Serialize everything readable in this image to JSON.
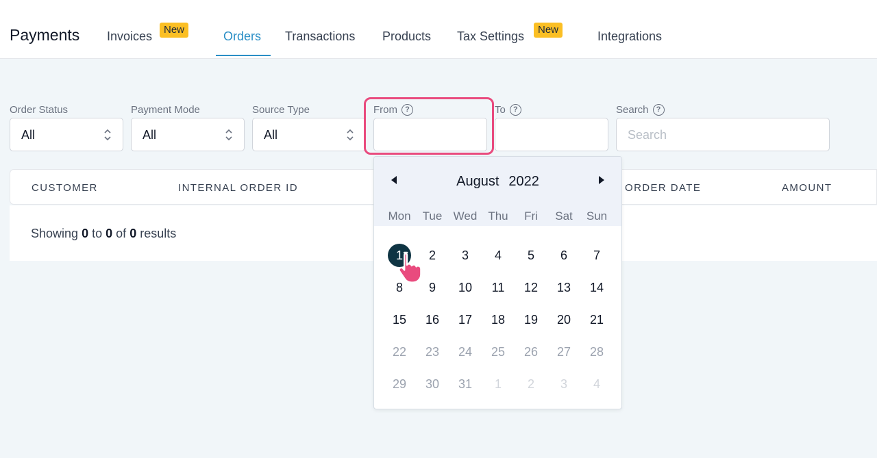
{
  "header": {
    "brand": "Payments",
    "tabs": [
      {
        "label": "Invoices",
        "badge": "New"
      },
      {
        "label": "Orders",
        "active": true
      },
      {
        "label": "Transactions"
      },
      {
        "label": "Products"
      },
      {
        "label": "Tax Settings",
        "badge": "New"
      },
      {
        "label": "Integrations"
      }
    ]
  },
  "filters": {
    "order_status": {
      "label": "Order Status",
      "value": "All"
    },
    "payment_mode": {
      "label": "Payment Mode",
      "value": "All"
    },
    "source_type": {
      "label": "Source Type",
      "value": "All"
    },
    "from": {
      "label": "From",
      "value": ""
    },
    "to": {
      "label": "To",
      "value": ""
    },
    "search": {
      "label": "Search",
      "placeholder": "Search",
      "value": ""
    }
  },
  "table": {
    "columns": [
      "CUSTOMER",
      "INTERNAL ORDER ID",
      "ORDER DATE",
      "AMOUNT"
    ],
    "showing": {
      "prefix": "Showing",
      "from": "0",
      "to_word": "to",
      "to": "0",
      "of_word": "of",
      "total": "0",
      "suffix": "results"
    }
  },
  "calendar": {
    "month": "August",
    "year": "2022",
    "weekdays": [
      "Mon",
      "Tue",
      "Wed",
      "Thu",
      "Fri",
      "Sat",
      "Sun"
    ],
    "weeks": [
      [
        "1",
        "2",
        "3",
        "4",
        "5",
        "6",
        "7"
      ],
      [
        "8",
        "9",
        "10",
        "11",
        "12",
        "13",
        "14"
      ],
      [
        "15",
        "16",
        "17",
        "18",
        "19",
        "20",
        "21"
      ],
      [
        "22",
        "23",
        "24",
        "25",
        "26",
        "27",
        "28"
      ],
      [
        "29",
        "30",
        "31",
        "1",
        "2",
        "3",
        "4"
      ]
    ],
    "selected": "1"
  },
  "colors": {
    "accent": "#2b8fc6",
    "badge": "#fbbf24",
    "highlight": "#e94b7e",
    "selected_day": "#0f3443",
    "cursor": "#e94b7e"
  },
  "icons": {
    "help": "question-circle-icon",
    "select": "chevron-updown-icon",
    "prev": "caret-left-icon",
    "next": "caret-right-icon",
    "cursor": "pointing-hand-cursor-icon"
  }
}
